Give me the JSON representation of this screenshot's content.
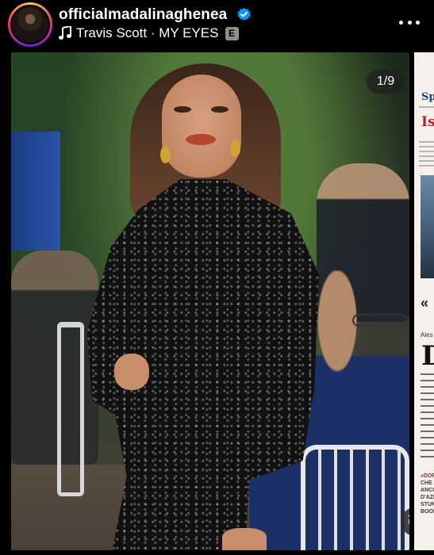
{
  "header": {
    "username": "officialmadalinaghenea",
    "verified": true,
    "music": {
      "artist_track": "Travis Scott · MY EYES",
      "explicit_label": "E"
    }
  },
  "carousel": {
    "counter": "1/9",
    "next_slide": {
      "heading_short": "Spo",
      "headline_short": "Ise",
      "quote_marks": "«",
      "byline": "Ales",
      "drop_cap": "D",
      "footer_lines": [
        "«DOP",
        "CHE F",
        "ANCO",
        "D'AZI",
        "STUN",
        "BOOK"
      ]
    }
  },
  "colors": {
    "background": "#000000",
    "verified_blue": "#0095f6",
    "explicit_badge": "#8e8e8e",
    "newspaper_red": "#b51f28",
    "newspaper_blue": "#1d3d6b"
  },
  "icons": {
    "music": "music-note-icon",
    "verified": "verified-badge-icon",
    "more": "more-dots-icon",
    "mute": "speaker-muted-icon"
  }
}
